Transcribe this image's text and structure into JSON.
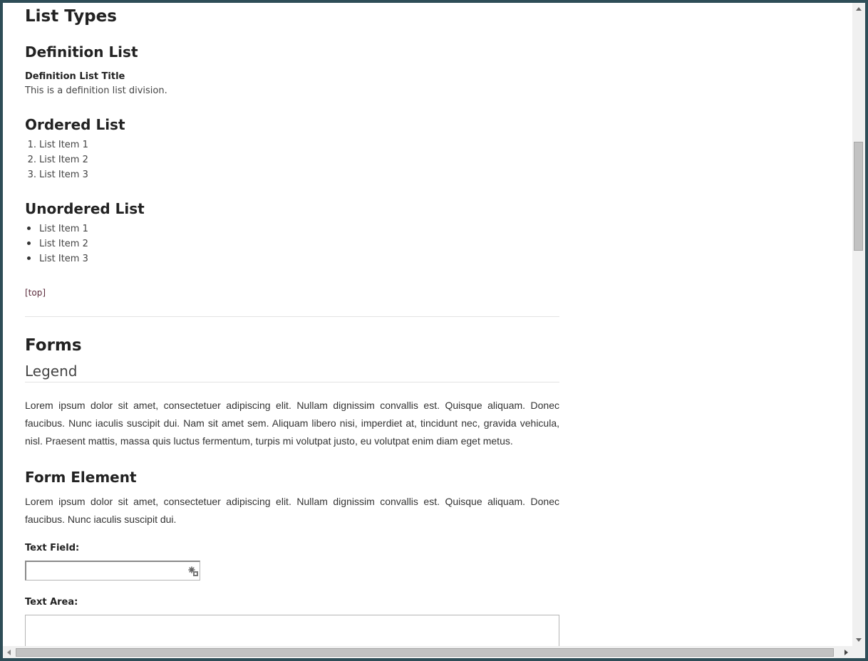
{
  "list_types": {
    "title": "List Types",
    "definition": {
      "heading": "Definition List",
      "term": "Definition List Title",
      "description": "This is a definition list division."
    },
    "ordered": {
      "heading": "Ordered List",
      "items": [
        {
          "marker": "1.",
          "label": "List Item 1"
        },
        {
          "marker": "2.",
          "label": "List Item 2"
        },
        {
          "marker": "3.",
          "label": "List Item 3"
        }
      ]
    },
    "unordered": {
      "heading": "Unordered List",
      "items": [
        "List Item 1",
        "List Item 2",
        "List Item 3"
      ]
    },
    "top_link": "[top]"
  },
  "forms": {
    "title": "Forms",
    "legend": "Legend",
    "intro": "Lorem ipsum dolor sit amet, consectetuer adipiscing elit. Nullam dignissim convallis est. Quisque aliquam. Donec faucibus. Nunc iaculis suscipit dui. Nam sit amet sem. Aliquam libero nisi, imperdiet at, tincidunt nec, gravida vehicula, nisl. Praesent mattis, massa quis luctus fermentum, turpis mi volutpat justo, eu volutpat enim diam eget metus.",
    "form_element": {
      "heading": "Form Element",
      "text": "Lorem ipsum dolor sit amet, consectetuer adipiscing elit. Nullam dignissim convallis est. Quisque aliquam. Donec faucibus. Nunc iaculis suscipit dui.",
      "text_field_label": "Text Field:",
      "text_field_value": "",
      "text_area_label": "Text Area:",
      "text_area_value": ""
    }
  },
  "colors": {
    "frame": "#2e4d57",
    "link": "#5a2a3a"
  }
}
